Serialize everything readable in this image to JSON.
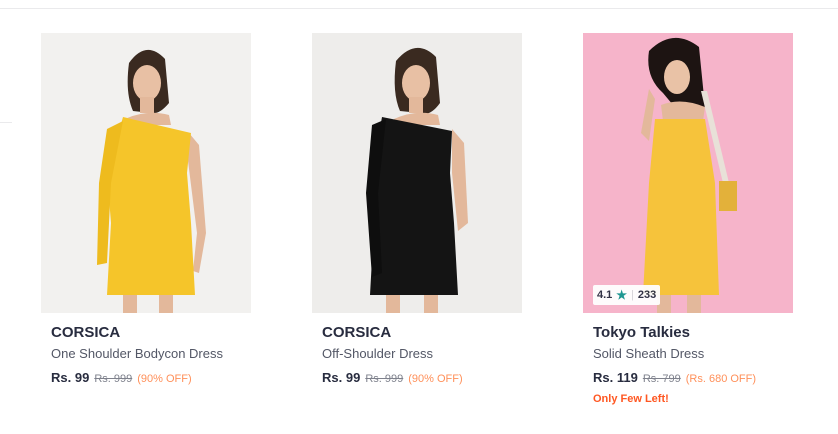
{
  "products": [
    {
      "brand": "CORSICA",
      "name": "One Shoulder Bodycon Dress",
      "price": "Rs. 99",
      "mrp": "Rs. 999",
      "discount": "(90% OFF)",
      "image_desc_icon": "yellow-dress-photo",
      "colors": {
        "bg": "#f2f1ef",
        "dress": "#f5c52a"
      }
    },
    {
      "brand": "CORSICA",
      "name": "Off-Shoulder Dress",
      "price": "Rs. 99",
      "mrp": "Rs. 999",
      "discount": "(90% OFF)",
      "image_desc_icon": "black-dress-photo",
      "colors": {
        "bg": "#eeedeb",
        "dress": "#141414"
      }
    },
    {
      "brand": "Tokyo Talkies",
      "name": "Solid Sheath Dress",
      "price": "Rs. 119",
      "mrp": "Rs. 799",
      "discount": "(Rs. 680 OFF)",
      "stock_note": "Only Few Left!",
      "rating": "4.1",
      "rating_count": "233",
      "image_desc_icon": "yellow-sheath-dress-photo",
      "colors": {
        "bg": "#f4a9c3",
        "dress": "#f6c33b"
      }
    }
  ]
}
